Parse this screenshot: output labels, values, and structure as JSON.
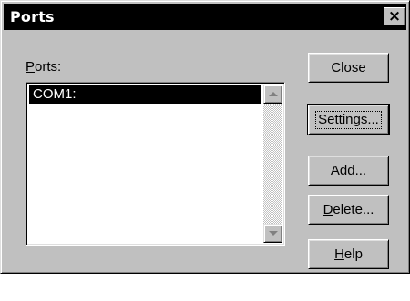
{
  "window": {
    "title": "Ports",
    "close_glyph": "×"
  },
  "ports": {
    "label_accel": "P",
    "label_rest": "orts:",
    "items": [
      "COM1:"
    ],
    "selected_index": 0
  },
  "buttons": {
    "close": {
      "label": "Close"
    },
    "settings": {
      "accel": "S",
      "rest": "ettings..."
    },
    "add": {
      "accel": "A",
      "rest": "dd..."
    },
    "delete": {
      "accel": "D",
      "rest": "elete..."
    },
    "help": {
      "accel": "H",
      "rest": "elp"
    }
  },
  "icons": {
    "close": "close-icon",
    "scroll_up": "scroll-up-arrow-icon",
    "scroll_down": "scroll-down-arrow-icon"
  },
  "colors": {
    "face": "#c0c0c0",
    "titlebar": "#000000",
    "selection": "#000000"
  }
}
